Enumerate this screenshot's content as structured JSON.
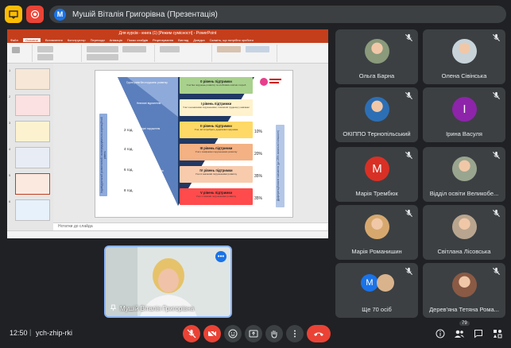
{
  "header": {
    "presenter_initial": "M",
    "presentation_title": "Мушій Віталія Григорівна (Презентація)"
  },
  "ppt": {
    "window_title": "Для курсів - книга (1) [Режим сумісності] - PowerPoint",
    "tabs": [
      "Файл",
      "Основне",
      "Вставлення",
      "Конструктор",
      "Переходи",
      "Анімація",
      "Показ слайдів",
      "Рецензування",
      "Вигляд",
      "Довідка",
      "Скажіть, що потрібно зробити"
    ],
    "notes_label": "Нотатки до слайда",
    "slide_numbers": [
      "1",
      "2",
      "3",
      "4",
      "5",
      "6"
    ]
  },
  "slide": {
    "side_left": "Індивідуальний розвитковий і попереджувально-корекційний рівень",
    "side_right": "Диференційоване навчання (до 25% загальної кількості)",
    "levels": [
      {
        "title": "0 рівень підтримки",
        "sub": "Учні без порушень розвитку та особливих освітніх потреб"
      },
      {
        "title": "I рівень підтримки",
        "sub": "Учні з незначними порушеннями; тимчасові труднощі у навчанні"
      },
      {
        "title": "II рівень підтримки",
        "sub": "Учні, які потребують додаткової підтримки"
      },
      {
        "title": "III рівень підтримки",
        "sub": "Учні з помірними порушеннями розвитку"
      },
      {
        "title": "IV рівень підтримки",
        "sub": "Учні зі значними порушеннями розвитку"
      },
      {
        "title": "V рівень підтримки",
        "sub": "Учні з тяжкими порушеннями розвитку"
      }
    ],
    "percents": [
      "10%",
      "20%",
      "35%",
      "35%"
    ],
    "years": [
      "2 год.",
      "4 год.",
      "6 год.",
      "8 год."
    ]
  },
  "participants": [
    {
      "name": "Ольга Барна",
      "avatar": "photo",
      "color": "#8a9a7b"
    },
    {
      "name": "Олена Сівінська",
      "avatar": "photo",
      "color": "#c7d3d9"
    },
    {
      "name": "ОКІППО Тернопільський",
      "avatar": "photo",
      "color": "#2d6fb5"
    },
    {
      "name": "Ірина Васуля",
      "avatar": "letter",
      "letter": "I",
      "color": "#8e24aa"
    },
    {
      "name": "Марія Трембюк",
      "avatar": "letter",
      "letter": "M",
      "color": "#d93025"
    },
    {
      "name": "Відділ освіти Великобе...",
      "avatar": "photo",
      "color": "#9aa58f"
    },
    {
      "name": "Марія Романишин",
      "avatar": "photo",
      "color": "#d7a86e"
    },
    {
      "name": "Світлана Лісовська",
      "avatar": "photo",
      "color": "#b9a58f"
    },
    {
      "name": "Ще 70 осіб",
      "avatar": "group",
      "letter": "M",
      "color": "#1a73e8"
    },
    {
      "name": "Дерев'яна Тетяна Рома...",
      "avatar": "photo",
      "color": "#8a5a44"
    }
  ],
  "presenter_tile": {
    "name": "Мушій Віталія Григорівна"
  },
  "bottom": {
    "time": "12:50",
    "separator": "|",
    "meeting_code": "ych-zhip-rki",
    "people_count": "79"
  }
}
